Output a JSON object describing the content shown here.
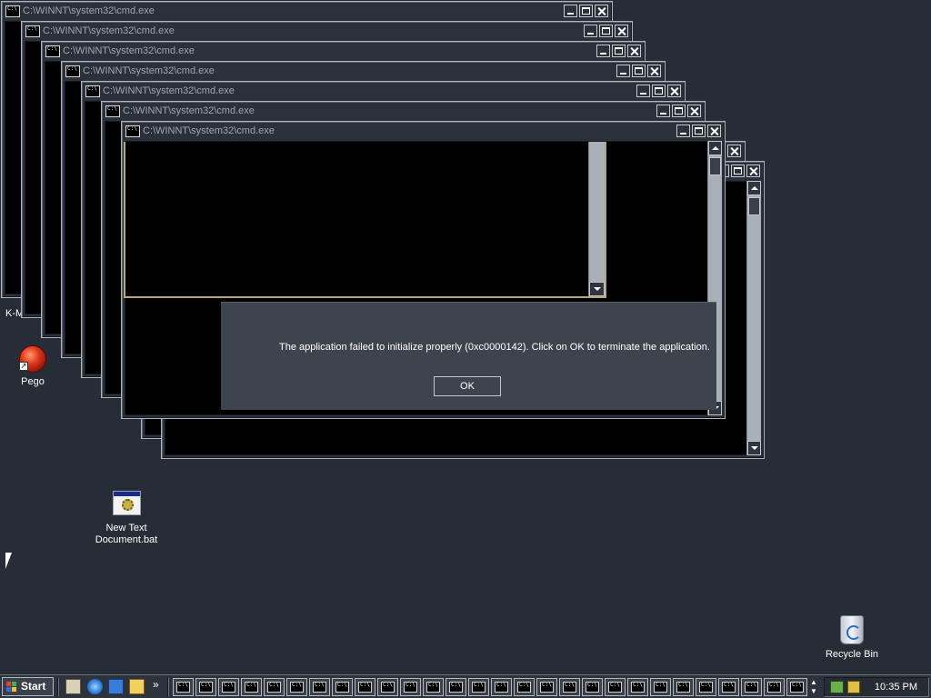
{
  "windows": {
    "title": "C:\\WINNT\\system32\\cmd.exe",
    "icon_label": "C:\\"
  },
  "error_dialog": {
    "message": "The application failed to initialize properly (0xc0000142). Click on OK to terminate the application.",
    "ok_label": "OK"
  },
  "desktop_icons": {
    "partial_label": "K-M",
    "pego": "Pego",
    "bat_line1": "New Text",
    "bat_line2": "Document.bat",
    "recycle_bin": "Recycle Bin"
  },
  "taskbar": {
    "start_label": "Start",
    "chevron": "»",
    "task_icon_label": "C:\\",
    "task_button_count": 28,
    "scroll_up": "▲",
    "scroll_down": "▼",
    "clock": "10:35 PM"
  },
  "icons": [
    "cmd-icon",
    "minimize-icon",
    "maximize-icon",
    "close-icon",
    "pego-icon",
    "batch-file-icon",
    "recycle-bin-icon",
    "windows-flag-icon",
    "show-desktop-icon",
    "internet-explorer-icon",
    "outlook-express-icon",
    "explorer-icon",
    "network-icon",
    "volume-icon",
    "mouse-cursor-icon"
  ]
}
